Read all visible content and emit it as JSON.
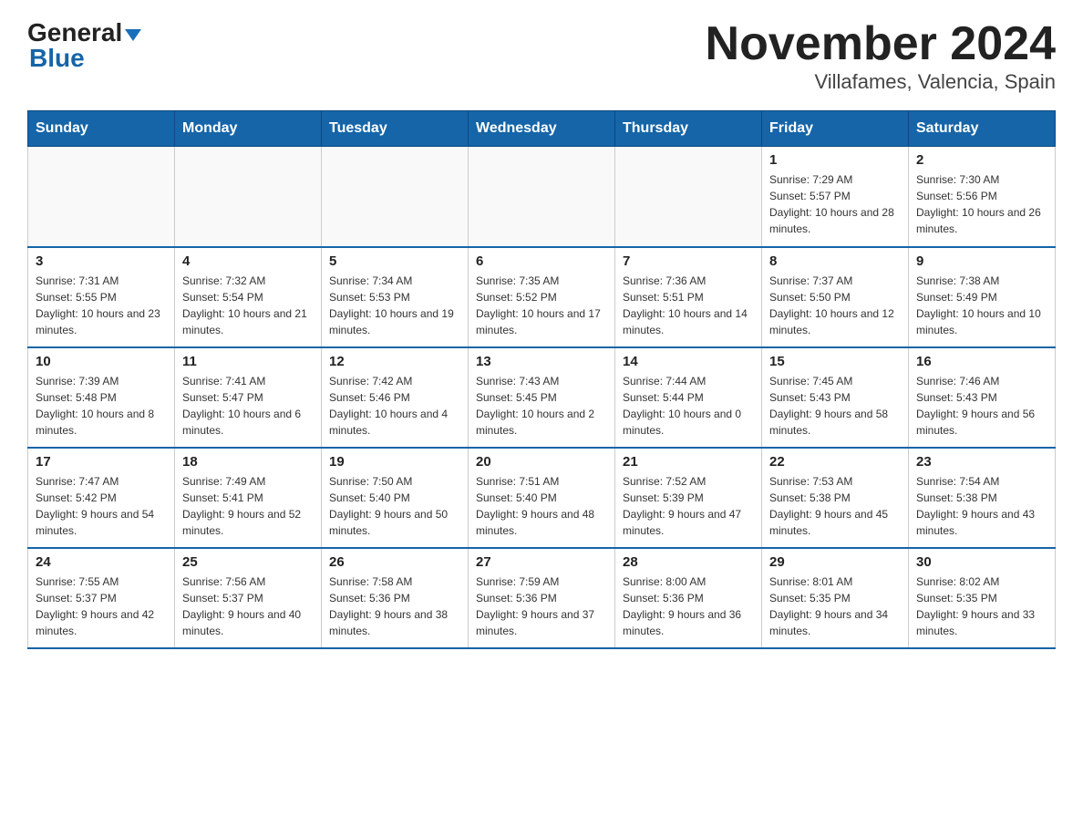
{
  "header": {
    "title": "November 2024",
    "subtitle": "Villafames, Valencia, Spain",
    "logo_general": "General",
    "logo_blue": "Blue"
  },
  "days_of_week": [
    "Sunday",
    "Monday",
    "Tuesday",
    "Wednesday",
    "Thursday",
    "Friday",
    "Saturday"
  ],
  "weeks": [
    [
      {
        "day": "",
        "info": ""
      },
      {
        "day": "",
        "info": ""
      },
      {
        "day": "",
        "info": ""
      },
      {
        "day": "",
        "info": ""
      },
      {
        "day": "",
        "info": ""
      },
      {
        "day": "1",
        "info": "Sunrise: 7:29 AM\nSunset: 5:57 PM\nDaylight: 10 hours and 28 minutes."
      },
      {
        "day": "2",
        "info": "Sunrise: 7:30 AM\nSunset: 5:56 PM\nDaylight: 10 hours and 26 minutes."
      }
    ],
    [
      {
        "day": "3",
        "info": "Sunrise: 7:31 AM\nSunset: 5:55 PM\nDaylight: 10 hours and 23 minutes."
      },
      {
        "day": "4",
        "info": "Sunrise: 7:32 AM\nSunset: 5:54 PM\nDaylight: 10 hours and 21 minutes."
      },
      {
        "day": "5",
        "info": "Sunrise: 7:34 AM\nSunset: 5:53 PM\nDaylight: 10 hours and 19 minutes."
      },
      {
        "day": "6",
        "info": "Sunrise: 7:35 AM\nSunset: 5:52 PM\nDaylight: 10 hours and 17 minutes."
      },
      {
        "day": "7",
        "info": "Sunrise: 7:36 AM\nSunset: 5:51 PM\nDaylight: 10 hours and 14 minutes."
      },
      {
        "day": "8",
        "info": "Sunrise: 7:37 AM\nSunset: 5:50 PM\nDaylight: 10 hours and 12 minutes."
      },
      {
        "day": "9",
        "info": "Sunrise: 7:38 AM\nSunset: 5:49 PM\nDaylight: 10 hours and 10 minutes."
      }
    ],
    [
      {
        "day": "10",
        "info": "Sunrise: 7:39 AM\nSunset: 5:48 PM\nDaylight: 10 hours and 8 minutes."
      },
      {
        "day": "11",
        "info": "Sunrise: 7:41 AM\nSunset: 5:47 PM\nDaylight: 10 hours and 6 minutes."
      },
      {
        "day": "12",
        "info": "Sunrise: 7:42 AM\nSunset: 5:46 PM\nDaylight: 10 hours and 4 minutes."
      },
      {
        "day": "13",
        "info": "Sunrise: 7:43 AM\nSunset: 5:45 PM\nDaylight: 10 hours and 2 minutes."
      },
      {
        "day": "14",
        "info": "Sunrise: 7:44 AM\nSunset: 5:44 PM\nDaylight: 10 hours and 0 minutes."
      },
      {
        "day": "15",
        "info": "Sunrise: 7:45 AM\nSunset: 5:43 PM\nDaylight: 9 hours and 58 minutes."
      },
      {
        "day": "16",
        "info": "Sunrise: 7:46 AM\nSunset: 5:43 PM\nDaylight: 9 hours and 56 minutes."
      }
    ],
    [
      {
        "day": "17",
        "info": "Sunrise: 7:47 AM\nSunset: 5:42 PM\nDaylight: 9 hours and 54 minutes."
      },
      {
        "day": "18",
        "info": "Sunrise: 7:49 AM\nSunset: 5:41 PM\nDaylight: 9 hours and 52 minutes."
      },
      {
        "day": "19",
        "info": "Sunrise: 7:50 AM\nSunset: 5:40 PM\nDaylight: 9 hours and 50 minutes."
      },
      {
        "day": "20",
        "info": "Sunrise: 7:51 AM\nSunset: 5:40 PM\nDaylight: 9 hours and 48 minutes."
      },
      {
        "day": "21",
        "info": "Sunrise: 7:52 AM\nSunset: 5:39 PM\nDaylight: 9 hours and 47 minutes."
      },
      {
        "day": "22",
        "info": "Sunrise: 7:53 AM\nSunset: 5:38 PM\nDaylight: 9 hours and 45 minutes."
      },
      {
        "day": "23",
        "info": "Sunrise: 7:54 AM\nSunset: 5:38 PM\nDaylight: 9 hours and 43 minutes."
      }
    ],
    [
      {
        "day": "24",
        "info": "Sunrise: 7:55 AM\nSunset: 5:37 PM\nDaylight: 9 hours and 42 minutes."
      },
      {
        "day": "25",
        "info": "Sunrise: 7:56 AM\nSunset: 5:37 PM\nDaylight: 9 hours and 40 minutes."
      },
      {
        "day": "26",
        "info": "Sunrise: 7:58 AM\nSunset: 5:36 PM\nDaylight: 9 hours and 38 minutes."
      },
      {
        "day": "27",
        "info": "Sunrise: 7:59 AM\nSunset: 5:36 PM\nDaylight: 9 hours and 37 minutes."
      },
      {
        "day": "28",
        "info": "Sunrise: 8:00 AM\nSunset: 5:36 PM\nDaylight: 9 hours and 36 minutes."
      },
      {
        "day": "29",
        "info": "Sunrise: 8:01 AM\nSunset: 5:35 PM\nDaylight: 9 hours and 34 minutes."
      },
      {
        "day": "30",
        "info": "Sunrise: 8:02 AM\nSunset: 5:35 PM\nDaylight: 9 hours and 33 minutes."
      }
    ]
  ]
}
